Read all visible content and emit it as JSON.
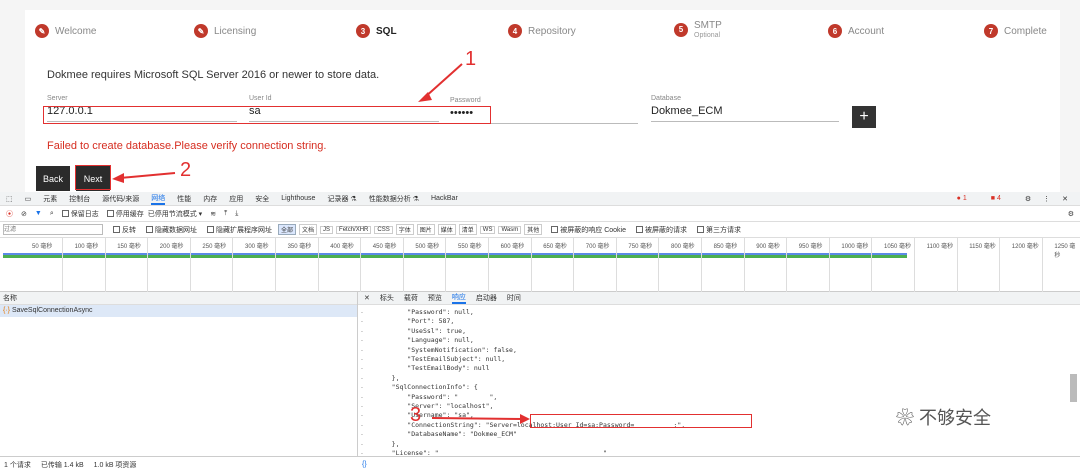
{
  "wizard": {
    "steps": [
      {
        "num": "",
        "label": "Welcome",
        "done": true
      },
      {
        "num": "",
        "label": "Licensing",
        "done": true
      },
      {
        "num": "3",
        "label": "SQL",
        "active": true
      },
      {
        "num": "4",
        "label": "Repository"
      },
      {
        "num": "5",
        "label": "SMTP",
        "sub": "Optional"
      },
      {
        "num": "6",
        "label": "Account"
      },
      {
        "num": "7",
        "label": "Complete"
      }
    ],
    "intro": "Dokmee requires Microsoft SQL Server 2016 or newer to store data.",
    "fields": {
      "server": {
        "label": "Server",
        "value": "127.0.0.1"
      },
      "userid": {
        "label": "User Id",
        "value": "sa"
      },
      "password": {
        "label": "Password",
        "value": "••••••"
      },
      "database": {
        "label": "Database",
        "value": "Dokmee_ECM"
      }
    },
    "add_label": "+",
    "error": "Failed to create database.Please verify connection string.",
    "back_label": "Back",
    "next_label": "Next"
  },
  "annotations": {
    "n1": "1",
    "n2": "2",
    "n3": "3"
  },
  "devtools": {
    "panels": [
      "元素",
      "控制台",
      "源代码/来源",
      "网络",
      "性能",
      "内存",
      "应用",
      "安全",
      "Lighthouse",
      "记录器 ⚗",
      "性能数据分析 ⚗",
      "HackBar"
    ],
    "active_panel": "网络",
    "badges": {
      "errors": "1",
      "warnings": "4"
    },
    "toolbar": {
      "preserve_log": "保留日志",
      "disable_cache": "停用缓存",
      "throttle": "已停用节流模式"
    },
    "filter": {
      "placeholder": "过滤",
      "invert": "反转",
      "hide_data": "隐藏数据网址",
      "hide_ext": "隐藏扩展程序网址",
      "types": [
        "全部",
        "文档",
        "JS",
        "Fetch/XHR",
        "CSS",
        "字体",
        "图片",
        "媒体",
        "清单",
        "WS",
        "Wasm",
        "其他"
      ],
      "blocked_cookie": "被屏蔽的响应 Cookie",
      "blocked_req": "被屏蔽的请求",
      "third_party": "第三方请求"
    },
    "timeline_ticks": [
      "50 毫秒",
      "100 毫秒",
      "150 毫秒",
      "200 毫秒",
      "250 毫秒",
      "300 毫秒",
      "350 毫秒",
      "400 毫秒",
      "450 毫秒",
      "500 毫秒",
      "550 毫秒",
      "600 毫秒",
      "650 毫秒",
      "700 毫秒",
      "750 毫秒",
      "800 毫秒",
      "850 毫秒",
      "900 毫秒",
      "950 毫秒",
      "1000 毫秒",
      "1050 毫秒",
      "1100 毫秒",
      "1150 毫秒",
      "1200 毫秒",
      "1250 毫秒"
    ],
    "name_header": "名称",
    "request_name": "SaveSqlConnectionAsync",
    "detail_tabs": [
      "标头",
      "载荷",
      "预览",
      "响应",
      "启动器",
      "时间"
    ],
    "active_detail": "响应",
    "code_lines": [
      "        \"Password\": null,",
      "        \"Port\": 587,",
      "        \"UseSsl\": true,",
      "        \"Language\": null,",
      "        \"SystemNotification\": false,",
      "        \"TestEmailSubject\": null,",
      "        \"TestEmailBody\": null",
      "    },",
      "    \"SqlConnectionInfo\": {",
      "        \"Password\": \"        \",",
      "        \"Server\": \"localhost\",",
      "        \"Username\": \"sa\",",
      "        \"ConnectionString\": \"Server=localhost;User Id=sa;Password=          ;\",",
      "        \"DatabaseName\": \"Dokmee_ECM\"",
      "    },",
      "    \"License\": \"                                          \""
    ],
    "status": {
      "requests": "1 个请求",
      "transferred": "已传输 1.4 kB",
      "resources": "1.0 kB 项资源"
    },
    "watermark": "不够安全"
  }
}
